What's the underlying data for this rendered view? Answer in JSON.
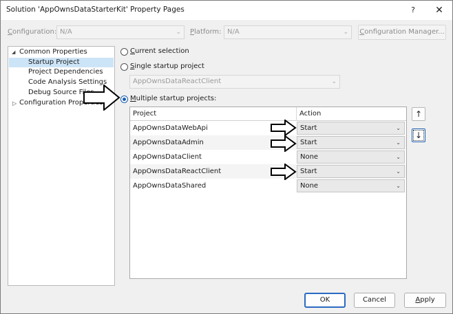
{
  "window": {
    "title": "Solution 'AppOwnsDataStarterKit' Property Pages",
    "help_glyph": "?",
    "close_glyph": "✕"
  },
  "toolbar": {
    "configuration_label": "Configuration:",
    "configuration_value": "N/A",
    "platform_label": "Platform:",
    "platform_value": "N/A",
    "configuration_manager_label": "Configuration Manager..."
  },
  "tree": {
    "common_properties": "Common Properties",
    "items": [
      "Startup Project",
      "Project Dependencies",
      "Code Analysis Settings",
      "Debug Source Files"
    ],
    "configuration_properties": "Configuration Properties"
  },
  "startup": {
    "current_selection": "Current selection",
    "single_startup": "Single startup project",
    "single_value": "AppOwnsDataReactClient",
    "multiple_startup": "Multiple startup projects:"
  },
  "grid": {
    "columns": [
      "Project",
      "Action"
    ],
    "rows": [
      {
        "project": "AppOwnsDataWebApi",
        "action": "Start"
      },
      {
        "project": "AppOwnsDataAdmin",
        "action": "Start"
      },
      {
        "project": "AppOwnsDataClient",
        "action": "None"
      },
      {
        "project": "AppOwnsDataReactClient",
        "action": "Start"
      },
      {
        "project": "AppOwnsDataShared",
        "action": "None"
      }
    ]
  },
  "buttons": {
    "ok": "OK",
    "cancel": "Cancel",
    "apply": "Apply"
  },
  "icons": {
    "move_up": "arrow-up-icon",
    "move_down": "arrow-down-icon",
    "callout": "outlined-arrow-icon"
  },
  "colors": {
    "accent": "#1a5fb4",
    "selection": "#cce4f7"
  }
}
